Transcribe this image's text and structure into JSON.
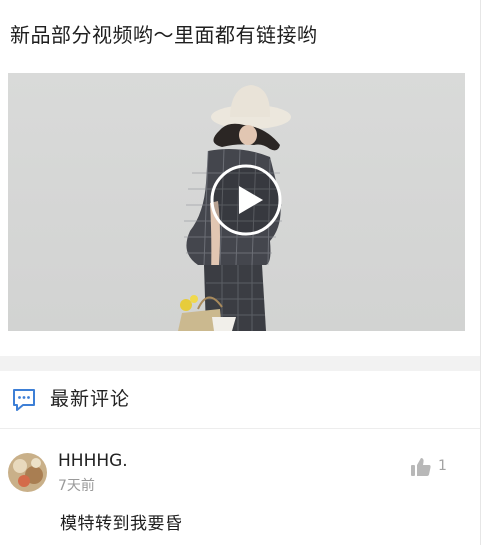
{
  "post": {
    "title": "新品部分视频哟～里面都有链接哟"
  },
  "video": {
    "play_icon": "play-icon"
  },
  "comments": {
    "header_icon": "comment-bubble-icon",
    "header_title": "最新评论",
    "items": [
      {
        "author": "HHHHG.",
        "time": "7天前",
        "text": "模特转到我要昏",
        "like_icon": "thumbs-up-icon",
        "likes": "1"
      }
    ]
  },
  "colors": {
    "accent": "#3d7fd6",
    "muted": "#9a9a9a",
    "separator": "#f2f2f2"
  }
}
